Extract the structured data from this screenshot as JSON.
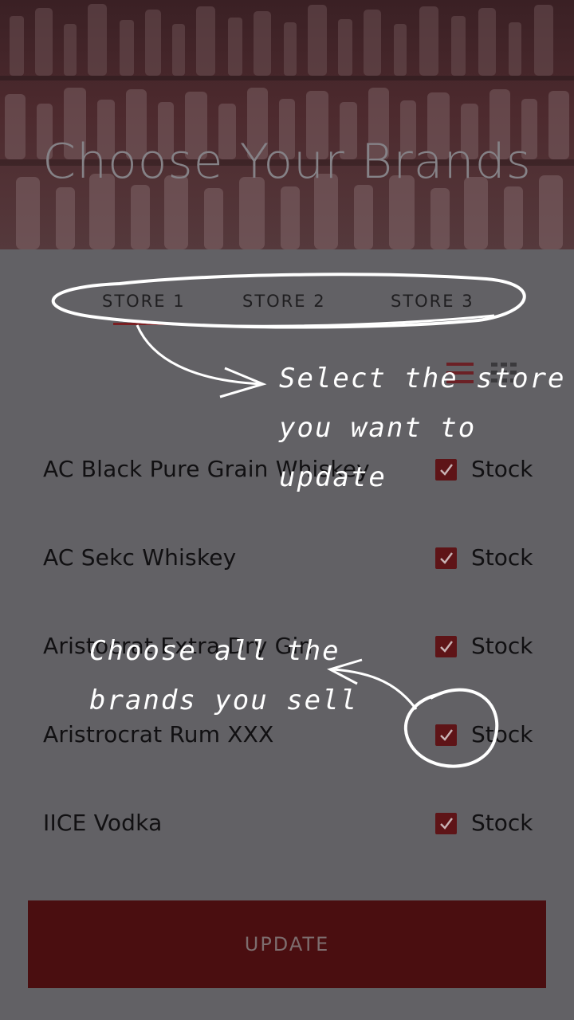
{
  "hero": {
    "title": "Choose Your Brands"
  },
  "tabs": [
    {
      "label": "STORE 1",
      "selected": true
    },
    {
      "label": "STORE 2",
      "selected": false
    },
    {
      "label": "STORE 3",
      "selected": false
    }
  ],
  "view_toggle": {
    "active": "list",
    "icons": [
      "list-view-icon",
      "grid-view-icon"
    ]
  },
  "brands": [
    {
      "name": "AC Black Pure Grain Whiskey",
      "checked": true,
      "stock_label": "Stock"
    },
    {
      "name": "AC Sekc Whiskey",
      "checked": true,
      "stock_label": "Stock"
    },
    {
      "name": "Aristocrat Extra Dry Gin",
      "checked": true,
      "stock_label": "Stock"
    },
    {
      "name": "Aristrocrat Rum XXX",
      "checked": true,
      "stock_label": "Stock"
    },
    {
      "name": "IICE Vodka",
      "checked": true,
      "stock_label": "Stock"
    }
  ],
  "update_button": {
    "label": "UPDATE"
  },
  "annotations": {
    "store_hint": [
      "Select the store",
      "you want to",
      "update"
    ],
    "brands_hint": [
      "Choose all the",
      "brands you sell"
    ]
  },
  "colors": {
    "accent": "#7a1f22",
    "checkbox": "#5e1417",
    "button": "#4a0e10",
    "overlay_bg": "#626165"
  }
}
